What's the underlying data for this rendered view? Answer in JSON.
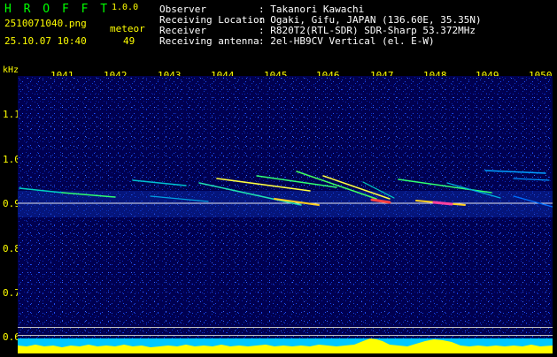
{
  "app": {
    "name": "H R O F F T",
    "version": "1.0.0"
  },
  "file": {
    "name": "2510071040.png",
    "datetime": "25.10.07 10:40"
  },
  "meteor": {
    "label": "meteor",
    "count": "49"
  },
  "info": [
    {
      "key": "Observer",
      "value": ": Takanori Kawachi"
    },
    {
      "key": "Receiving Location",
      "value": ": Ogaki, Gifu, JAPAN (136.60E, 35.35N)"
    },
    {
      "key": "Receiver",
      "value": ": R820T2(RTL-SDR) SDR-Sharp 53.372MHz"
    },
    {
      "key": "Receiving antenna",
      "value": ": 2el-HB9CV Vertical (el. E-W)"
    }
  ],
  "axis": {
    "unit": "kHz",
    "x_ticks": [
      "1041",
      "1042",
      "1043",
      "1044",
      "1045",
      "1046",
      "1047",
      "1048",
      "1049",
      "1050"
    ],
    "y_ticks": [
      "1.1",
      "1.0",
      "0.9",
      "0.8",
      "0.7",
      "0.6"
    ]
  },
  "colors": {
    "header_green": "#00ff00",
    "header_yellow": "#ffff00",
    "plot_bg": "#000050",
    "carrier": "#ffffff",
    "strip_cyan": "#00c8ff",
    "strip_yellow": "#ffff00"
  }
}
